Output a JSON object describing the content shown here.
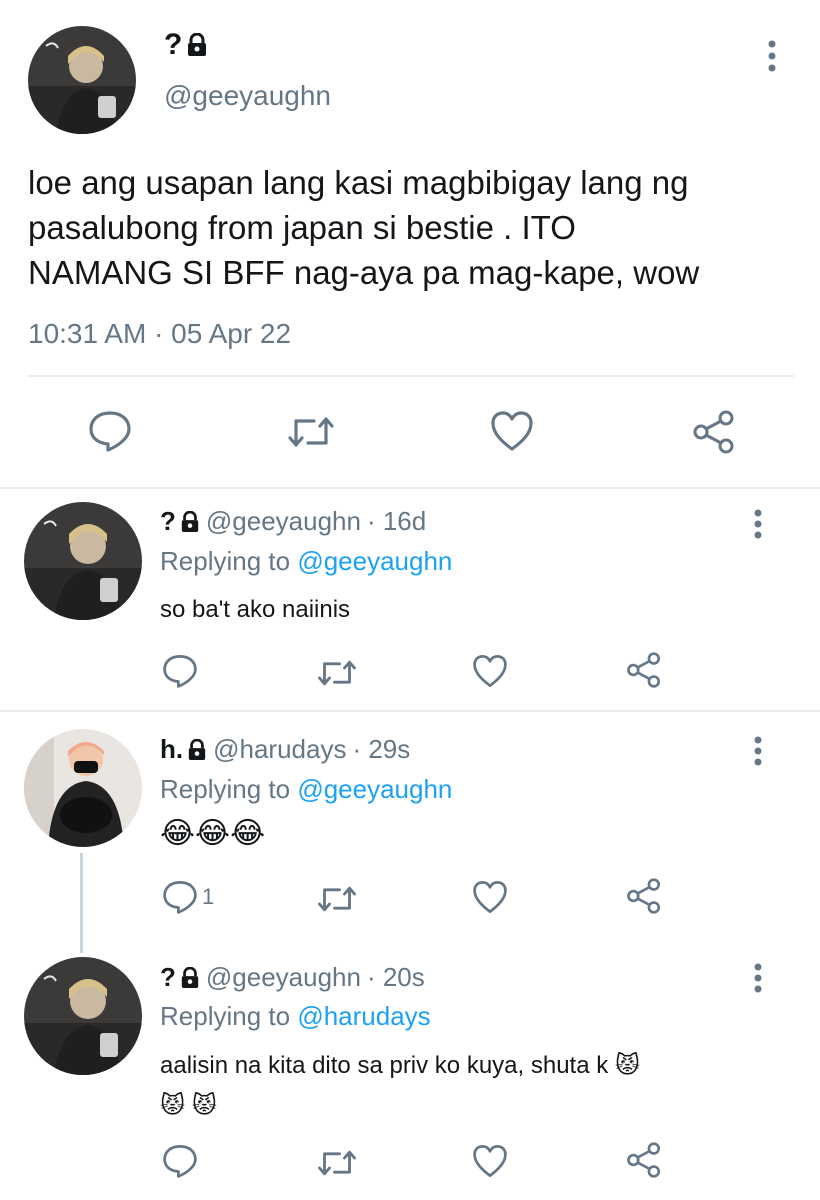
{
  "main_tweet": {
    "display_name": "?",
    "handle": "@geeyaughn",
    "text_lines": [
      "loe ang usapan lang kasi magbibigay lang ng",
      "pasalubong from japan si bestie . ITO",
      "NAMANG SI BFF nag-aya pa mag-kape, wow"
    ],
    "timestamp": "10:31 AM · 05 Apr 22"
  },
  "replies": [
    {
      "display_name": "?",
      "handle": "@geeyaughn",
      "time": "· 16d",
      "replying_label": "Replying to",
      "replying_to": "@geeyaughn",
      "text_lines": [
        "so ba't ako naiinis"
      ],
      "reply_count": ""
    },
    {
      "display_name": "h.",
      "handle": "@harudays",
      "time": "· 29s",
      "replying_label": "Replying to",
      "replying_to": "@geeyaughn",
      "text_lines": [
        "😂😂😂"
      ],
      "reply_count": "1"
    },
    {
      "display_name": "?",
      "handle": "@geeyaughn",
      "time": "· 20s",
      "replying_label": "Replying to",
      "replying_to": "@harudays",
      "text_lines": [
        "aalisin na kita dito sa priv ko kuya, shuta k 😾",
        "😾 😾"
      ],
      "reply_count": ""
    }
  ],
  "icons": {
    "more": "more-vertical-icon",
    "lock": "lock-icon",
    "reply": "reply-icon",
    "retweet": "retweet-icon",
    "like": "heart-icon",
    "share": "share-icon"
  },
  "colors": {
    "link": "#1da1f2",
    "muted": "#657786",
    "divider": "#e6ecf0",
    "icon": "#657786"
  }
}
